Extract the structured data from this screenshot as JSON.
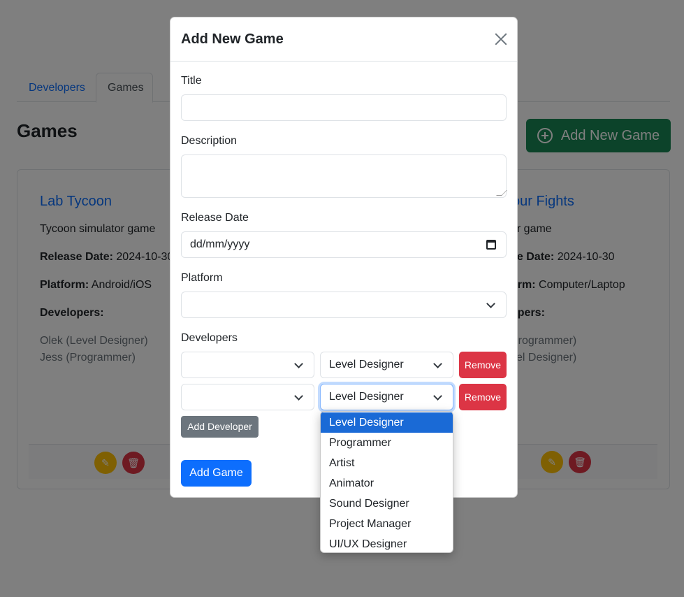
{
  "tabs": [
    {
      "label": "Developers",
      "active": false
    },
    {
      "label": "Games",
      "active": true
    }
  ],
  "section_title": "Games",
  "add_new_button": {
    "label": "Add New Game",
    "icon": "plus-circle-icon",
    "color": "#198754"
  },
  "cards": [
    {
      "title": "Lab Tycoon",
      "description": "Tycoon simulator game",
      "release_label": "Release Date:",
      "release_value": "2024-10-30",
      "platform_label": "Platform:",
      "platform_value": "Android/iOS",
      "developers_label": "Developers:",
      "developers": [
        "Olek (Level Designer)",
        "Jess (Programmer)"
      ]
    },
    {
      "title": "our Fights",
      "description": "ur game",
      "release_label": "se Date:",
      "release_value": "2024-10-30",
      "platform_label": "orm:",
      "platform_value": "Computer/Laptop",
      "developers_label": "opers:",
      "developers": [
        "Programmer)",
        "vel Designer)"
      ]
    }
  ],
  "modal": {
    "title": "Add New Game",
    "fields": {
      "title_label": "Title",
      "title_value": "",
      "description_label": "Description",
      "description_value": "",
      "release_date_label": "Release Date",
      "release_date_placeholder": "dd/mm/yyyy",
      "platform_label": "Platform",
      "platform_value": "",
      "developers_label": "Developers"
    },
    "developer_rows": [
      {
        "developer": "",
        "role": "Level Designer",
        "remove_label": "Remove"
      },
      {
        "developer": "",
        "role": "Level Designer",
        "remove_label": "Remove"
      }
    ],
    "add_developer_label": "Add Developer",
    "add_game_label": "Add Game"
  },
  "role_dropdown": {
    "options": [
      "Level Designer",
      "Programmer",
      "Artist",
      "Animator",
      "Sound Designer",
      "Project Manager",
      "UI/UX Designer"
    ],
    "selected": "Level Designer"
  },
  "colors": {
    "primary": "#0d6efd",
    "danger": "#dc3545",
    "success": "#198754",
    "secondary": "#6c757d",
    "warning": "#ffc107"
  }
}
